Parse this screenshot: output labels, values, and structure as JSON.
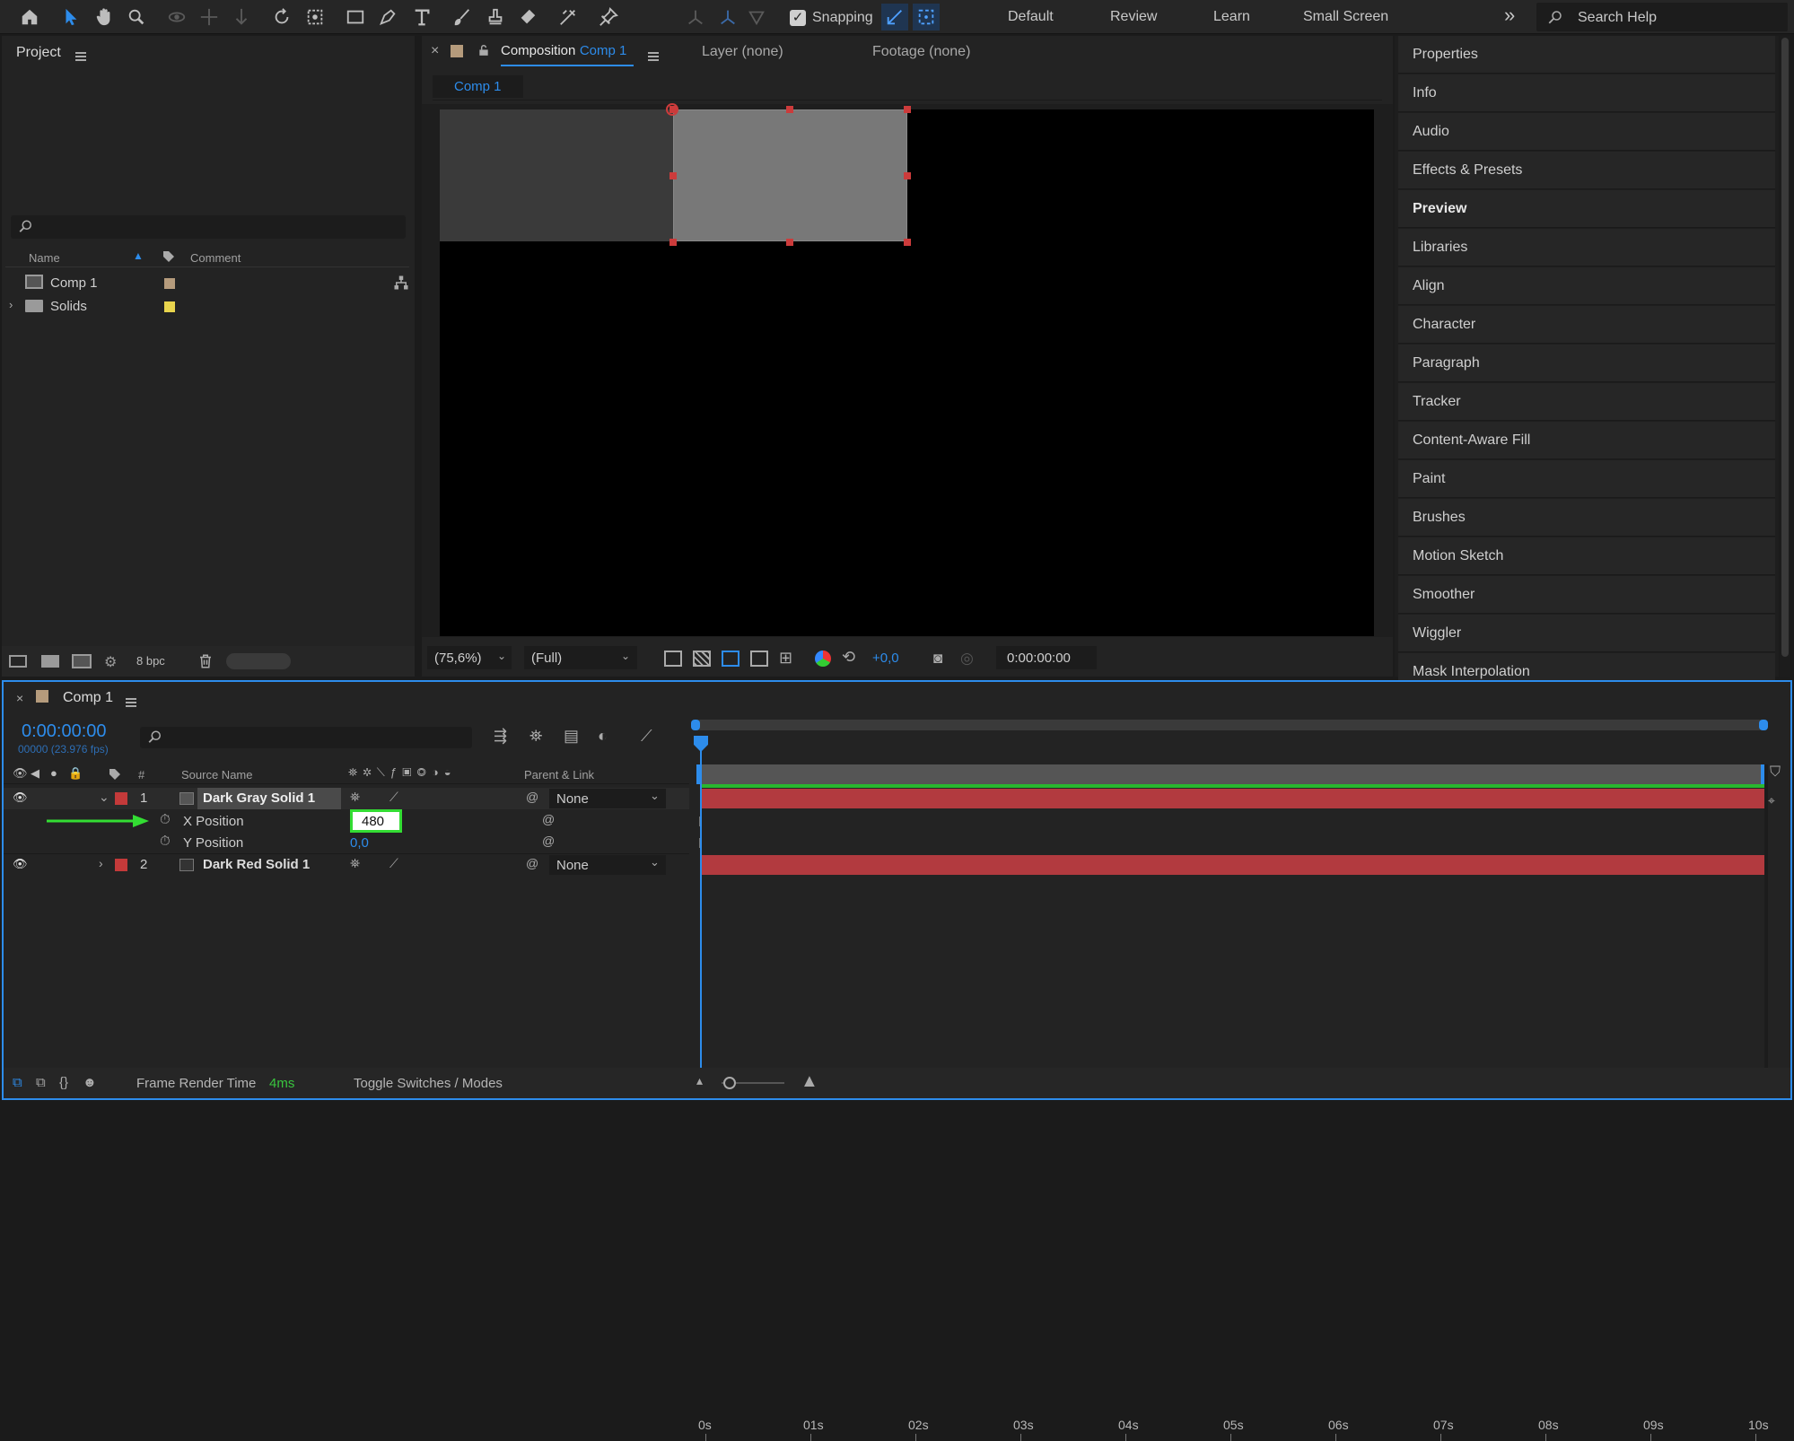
{
  "toolbar": {
    "snapping_label": "Snapping",
    "workspaces": [
      "Default",
      "Review",
      "Learn",
      "Small Screen"
    ],
    "overflow": "»",
    "search_placeholder": "Search Help"
  },
  "project": {
    "title": "Project",
    "columns": {
      "name": "Name",
      "comment": "Comment"
    },
    "items": [
      {
        "name": "Comp 1",
        "label_color": "#b59b7c"
      },
      {
        "name": "Solids",
        "label_color": "#e8d44d"
      }
    ],
    "bpc": "8 bpc"
  },
  "viewer": {
    "tabs": [
      {
        "prefix": "Composition",
        "name": "Comp 1"
      },
      {
        "name": "Layer (none)"
      },
      {
        "name": "Footage (none)"
      }
    ],
    "comp_tab": "Comp 1",
    "zoom": "(75,6%)",
    "resolution": "(Full)",
    "exposure": "+0,0",
    "timecode": "0:00:00:00"
  },
  "right_panels": [
    "Properties",
    "Info",
    "Audio",
    "Effects & Presets",
    "Preview",
    "Libraries",
    "Align",
    "Character",
    "Paragraph",
    "Tracker",
    "Content-Aware Fill",
    "Paint",
    "Brushes",
    "Motion Sketch",
    "Smoother",
    "Wiggler",
    "Mask Interpolation"
  ],
  "timeline": {
    "tab": "Comp 1",
    "timecode": "0:00:00:00",
    "fps": "00000 (23.976 fps)",
    "headers": {
      "num": "#",
      "source": "Source Name",
      "parent": "Parent & Link"
    },
    "layers": [
      {
        "num": "1",
        "name": "Dark Gray Solid 1",
        "parent": "None",
        "label_color": "#c43a3a"
      },
      {
        "num": "2",
        "name": "Dark Red Solid 1",
        "parent": "None",
        "label_color": "#c43a3a"
      }
    ],
    "props": [
      {
        "name": "X Position",
        "value": "480"
      },
      {
        "name": "Y Position",
        "value": "0,0"
      }
    ],
    "ruler": [
      "0s",
      "01s",
      "02s",
      "03s",
      "04s",
      "05s",
      "06s",
      "07s",
      "08s",
      "09s",
      "10s"
    ],
    "frame_render_label": "Frame Render Time",
    "frame_render_value": "4ms",
    "toggle_label": "Toggle Switches / Modes"
  },
  "colors": {
    "accent": "#2d8ceb",
    "highlight": "#33dd33",
    "layer_bar": "#b23a3f"
  }
}
